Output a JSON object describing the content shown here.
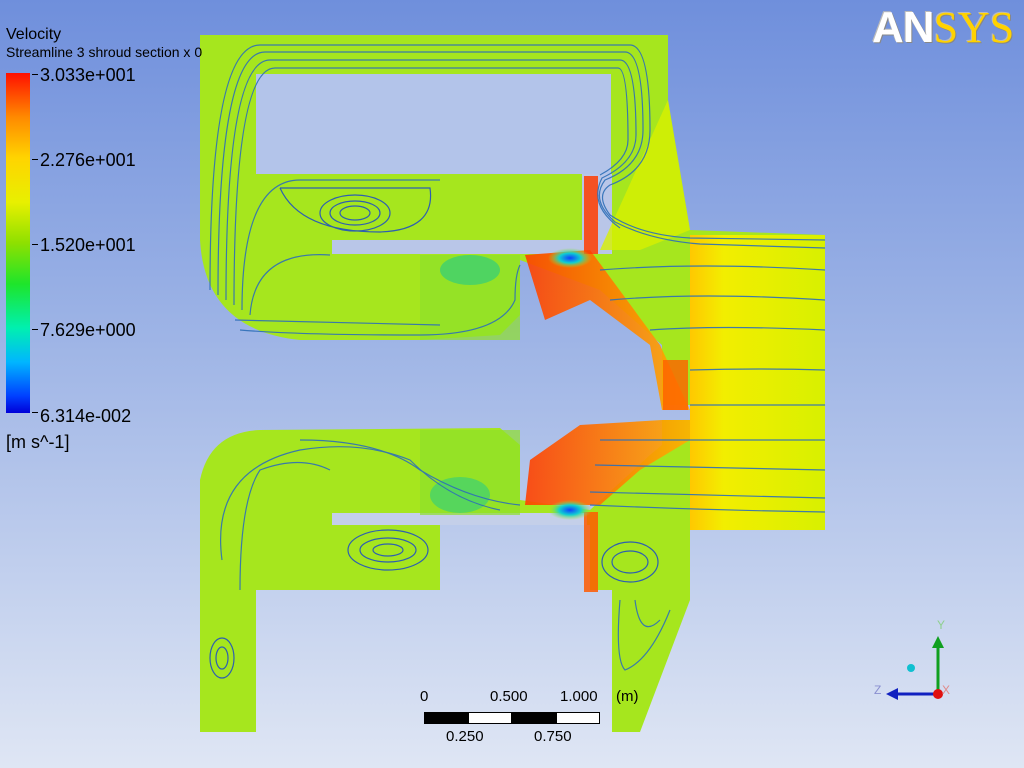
{
  "legend": {
    "title": "Velocity",
    "subtitle": "Streamline 3 shroud section x 0",
    "ticks": [
      "3.033e+001",
      "2.276e+001",
      "1.520e+001",
      "7.629e+000",
      "6.314e-002"
    ],
    "units": "[m s^-1]",
    "colors": {
      "max": "#ff1000",
      "mid": "#1ee52a",
      "min": "#0000d8"
    }
  },
  "logo": {
    "text_a": "AN",
    "text_b": "SYS"
  },
  "scale_bar": {
    "top_labels": [
      "0",
      "0.500",
      "1.000",
      "(m)"
    ],
    "bottom_labels": [
      "0.250",
      "0.750"
    ]
  },
  "axis_triad": {
    "y": "Y",
    "z": "Z",
    "x": "X"
  },
  "colors": {
    "field_base": "#a6e61e",
    "streamline": "#2e6fb8",
    "hot": "#ff3c00",
    "warm": "#ffd000",
    "cool": "#22cc66"
  }
}
